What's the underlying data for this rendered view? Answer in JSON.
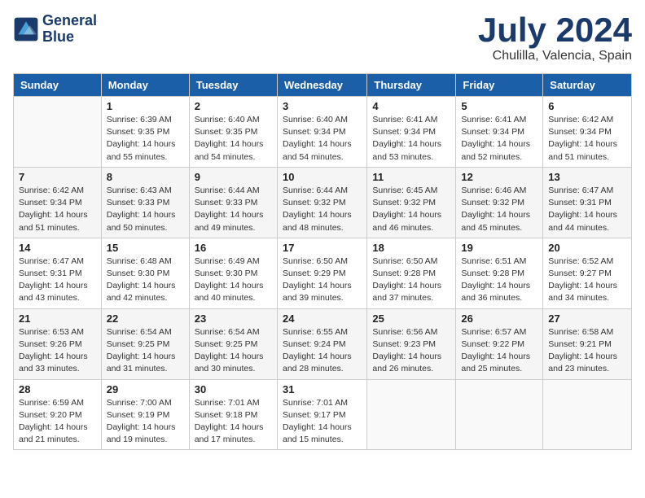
{
  "logo": {
    "line1": "General",
    "line2": "Blue"
  },
  "title": "July 2024",
  "subtitle": "Chulilla, Valencia, Spain",
  "days_of_week": [
    "Sunday",
    "Monday",
    "Tuesday",
    "Wednesday",
    "Thursday",
    "Friday",
    "Saturday"
  ],
  "weeks": [
    [
      {
        "day": "",
        "sunrise": "",
        "sunset": "",
        "daylight": ""
      },
      {
        "day": "1",
        "sunrise": "Sunrise: 6:39 AM",
        "sunset": "Sunset: 9:35 PM",
        "daylight": "Daylight: 14 hours and 55 minutes."
      },
      {
        "day": "2",
        "sunrise": "Sunrise: 6:40 AM",
        "sunset": "Sunset: 9:35 PM",
        "daylight": "Daylight: 14 hours and 54 minutes."
      },
      {
        "day": "3",
        "sunrise": "Sunrise: 6:40 AM",
        "sunset": "Sunset: 9:34 PM",
        "daylight": "Daylight: 14 hours and 54 minutes."
      },
      {
        "day": "4",
        "sunrise": "Sunrise: 6:41 AM",
        "sunset": "Sunset: 9:34 PM",
        "daylight": "Daylight: 14 hours and 53 minutes."
      },
      {
        "day": "5",
        "sunrise": "Sunrise: 6:41 AM",
        "sunset": "Sunset: 9:34 PM",
        "daylight": "Daylight: 14 hours and 52 minutes."
      },
      {
        "day": "6",
        "sunrise": "Sunrise: 6:42 AM",
        "sunset": "Sunset: 9:34 PM",
        "daylight": "Daylight: 14 hours and 51 minutes."
      }
    ],
    [
      {
        "day": "7",
        "sunrise": "Sunrise: 6:42 AM",
        "sunset": "Sunset: 9:34 PM",
        "daylight": "Daylight: 14 hours and 51 minutes."
      },
      {
        "day": "8",
        "sunrise": "Sunrise: 6:43 AM",
        "sunset": "Sunset: 9:33 PM",
        "daylight": "Daylight: 14 hours and 50 minutes."
      },
      {
        "day": "9",
        "sunrise": "Sunrise: 6:44 AM",
        "sunset": "Sunset: 9:33 PM",
        "daylight": "Daylight: 14 hours and 49 minutes."
      },
      {
        "day": "10",
        "sunrise": "Sunrise: 6:44 AM",
        "sunset": "Sunset: 9:32 PM",
        "daylight": "Daylight: 14 hours and 48 minutes."
      },
      {
        "day": "11",
        "sunrise": "Sunrise: 6:45 AM",
        "sunset": "Sunset: 9:32 PM",
        "daylight": "Daylight: 14 hours and 46 minutes."
      },
      {
        "day": "12",
        "sunrise": "Sunrise: 6:46 AM",
        "sunset": "Sunset: 9:32 PM",
        "daylight": "Daylight: 14 hours and 45 minutes."
      },
      {
        "day": "13",
        "sunrise": "Sunrise: 6:47 AM",
        "sunset": "Sunset: 9:31 PM",
        "daylight": "Daylight: 14 hours and 44 minutes."
      }
    ],
    [
      {
        "day": "14",
        "sunrise": "Sunrise: 6:47 AM",
        "sunset": "Sunset: 9:31 PM",
        "daylight": "Daylight: 14 hours and 43 minutes."
      },
      {
        "day": "15",
        "sunrise": "Sunrise: 6:48 AM",
        "sunset": "Sunset: 9:30 PM",
        "daylight": "Daylight: 14 hours and 42 minutes."
      },
      {
        "day": "16",
        "sunrise": "Sunrise: 6:49 AM",
        "sunset": "Sunset: 9:30 PM",
        "daylight": "Daylight: 14 hours and 40 minutes."
      },
      {
        "day": "17",
        "sunrise": "Sunrise: 6:50 AM",
        "sunset": "Sunset: 9:29 PM",
        "daylight": "Daylight: 14 hours and 39 minutes."
      },
      {
        "day": "18",
        "sunrise": "Sunrise: 6:50 AM",
        "sunset": "Sunset: 9:28 PM",
        "daylight": "Daylight: 14 hours and 37 minutes."
      },
      {
        "day": "19",
        "sunrise": "Sunrise: 6:51 AM",
        "sunset": "Sunset: 9:28 PM",
        "daylight": "Daylight: 14 hours and 36 minutes."
      },
      {
        "day": "20",
        "sunrise": "Sunrise: 6:52 AM",
        "sunset": "Sunset: 9:27 PM",
        "daylight": "Daylight: 14 hours and 34 minutes."
      }
    ],
    [
      {
        "day": "21",
        "sunrise": "Sunrise: 6:53 AM",
        "sunset": "Sunset: 9:26 PM",
        "daylight": "Daylight: 14 hours and 33 minutes."
      },
      {
        "day": "22",
        "sunrise": "Sunrise: 6:54 AM",
        "sunset": "Sunset: 9:25 PM",
        "daylight": "Daylight: 14 hours and 31 minutes."
      },
      {
        "day": "23",
        "sunrise": "Sunrise: 6:54 AM",
        "sunset": "Sunset: 9:25 PM",
        "daylight": "Daylight: 14 hours and 30 minutes."
      },
      {
        "day": "24",
        "sunrise": "Sunrise: 6:55 AM",
        "sunset": "Sunset: 9:24 PM",
        "daylight": "Daylight: 14 hours and 28 minutes."
      },
      {
        "day": "25",
        "sunrise": "Sunrise: 6:56 AM",
        "sunset": "Sunset: 9:23 PM",
        "daylight": "Daylight: 14 hours and 26 minutes."
      },
      {
        "day": "26",
        "sunrise": "Sunrise: 6:57 AM",
        "sunset": "Sunset: 9:22 PM",
        "daylight": "Daylight: 14 hours and 25 minutes."
      },
      {
        "day": "27",
        "sunrise": "Sunrise: 6:58 AM",
        "sunset": "Sunset: 9:21 PM",
        "daylight": "Daylight: 14 hours and 23 minutes."
      }
    ],
    [
      {
        "day": "28",
        "sunrise": "Sunrise: 6:59 AM",
        "sunset": "Sunset: 9:20 PM",
        "daylight": "Daylight: 14 hours and 21 minutes."
      },
      {
        "day": "29",
        "sunrise": "Sunrise: 7:00 AM",
        "sunset": "Sunset: 9:19 PM",
        "daylight": "Daylight: 14 hours and 19 minutes."
      },
      {
        "day": "30",
        "sunrise": "Sunrise: 7:01 AM",
        "sunset": "Sunset: 9:18 PM",
        "daylight": "Daylight: 14 hours and 17 minutes."
      },
      {
        "day": "31",
        "sunrise": "Sunrise: 7:01 AM",
        "sunset": "Sunset: 9:17 PM",
        "daylight": "Daylight: 14 hours and 15 minutes."
      },
      {
        "day": "",
        "sunrise": "",
        "sunset": "",
        "daylight": ""
      },
      {
        "day": "",
        "sunrise": "",
        "sunset": "",
        "daylight": ""
      },
      {
        "day": "",
        "sunrise": "",
        "sunset": "",
        "daylight": ""
      }
    ]
  ]
}
